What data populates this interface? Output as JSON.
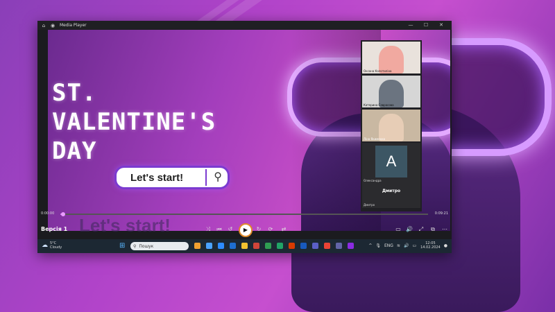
{
  "window": {
    "title": "Media Player",
    "home_icon": "⌂",
    "controls": [
      "—",
      "☐",
      "✕"
    ]
  },
  "video": {
    "title_lines": [
      "ST.",
      "VALENTINE'S",
      "DAY"
    ],
    "search_text": "Let's start!",
    "search_icon": "⚲"
  },
  "participants": [
    {
      "name": "Оксана Колотиліна"
    },
    {
      "name": "Катерина Саврасова"
    },
    {
      "name": "Ліна Якименко"
    },
    {
      "name": "Олександра"
    }
  ],
  "big_tile": {
    "avatar_letter": "A",
    "name": "Дмитро",
    "sub_name": "Дмитро"
  },
  "player": {
    "time_elapsed": "0:00:00",
    "time_total": "0:09:21",
    "progress": 0.003,
    "version_label": "Версія 1",
    "ghost_text": "Let's start!",
    "buttons": {
      "shuffle": "⤨",
      "prev": "⏮",
      "rewind": "↺",
      "play": "▶",
      "forward": "↻",
      "repeat": "⟳",
      "miniplayer": "▭",
      "volume": "🔊",
      "fullscreen": "⤢",
      "cast": "⧉",
      "more": "⋯"
    }
  },
  "taskbar": {
    "weather_temp": "5°C",
    "weather_desc": "Cloudy",
    "search_placeholder": "Пошук",
    "lang": "ENG",
    "time": "12:05",
    "date": "14.02.2024",
    "icon_colors": [
      "#f0a030",
      "#4aa3ff",
      "#2d8cff",
      "#1e6fd0",
      "#f2c230",
      "#d0453a",
      "#2f9e52",
      "#21a366",
      "#d83b01",
      "#185abd",
      "#5b5fc7",
      "#ea4335",
      "#6264a7",
      "#8a2be2"
    ]
  }
}
